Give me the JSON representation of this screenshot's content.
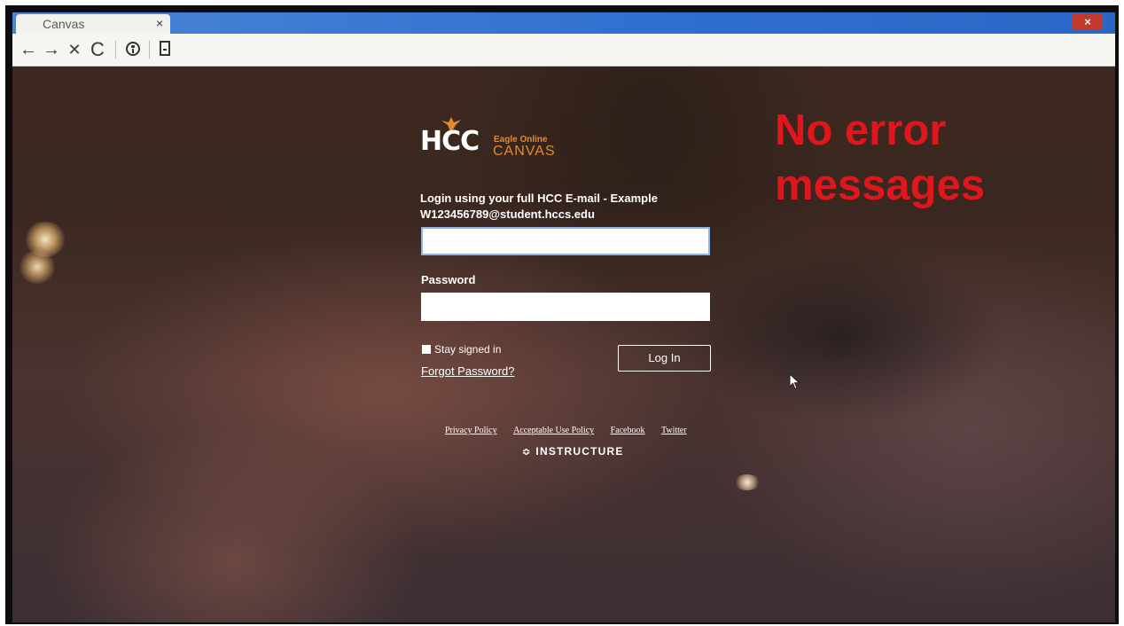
{
  "browser": {
    "tab_title": "Canvas",
    "tab_close": "×",
    "window_close": "×"
  },
  "toolbar": {
    "back_icon": "←",
    "forward_icon": "→",
    "stop_icon": "✕",
    "reload_icon": "C"
  },
  "logo": {
    "main": "HCC",
    "sub_top": "Eagle Online",
    "sub_bottom": "CANVAS"
  },
  "login": {
    "prompt": "Login using your full HCC E-mail - Example W123456789@student.hccs.edu",
    "email_value": "",
    "password_label": "Password",
    "password_value": "",
    "stay_signed_in": "Stay signed in",
    "forgot_password": "Forgot Password?",
    "login_button": "Log In"
  },
  "footer": {
    "links": [
      "Privacy Policy",
      "Acceptable Use Policy",
      "Facebook",
      "Twitter"
    ],
    "brand": "INSTRUCTURE"
  },
  "annotation": {
    "text_line1": "No error",
    "text_line2": "messages",
    "color": "#e0161d"
  },
  "colors": {
    "logo_accent": "#e38a2b",
    "tabbar": "#2f6fd0"
  }
}
